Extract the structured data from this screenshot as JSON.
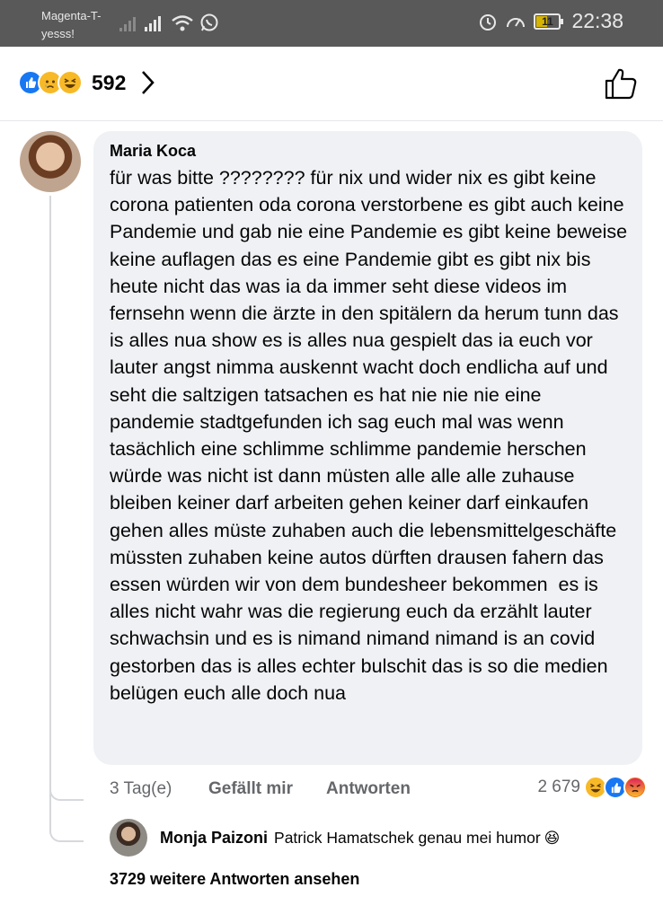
{
  "status_bar": {
    "carrier": "Magenta-T-yesss!",
    "battery": "11",
    "time": "22:38"
  },
  "header": {
    "reaction_count": "592",
    "reactions": [
      "like-icon",
      "sad-icon",
      "haha-icon"
    ]
  },
  "comment": {
    "author": "Maria Koca",
    "text": "für was bitte ???????? für nix und wider nix es gibt keine corona patienten oda corona verstorbene es gibt auch keine Pandemie und gab nie eine Pandemie es gibt keine beweise keine auflagen das es eine Pandemie gibt es gibt nix bis heute nicht das was ia da immer seht diese videos im fernsehn wenn die ärzte in den spitälern da herum tunn das is alles nua show es is alles nua gespielt das ia euch vor lauter angst nimma auskennt wacht doch endlicha auf und seht die saltzigen tatsachen es hat nie nie nie eine pandemie stadtgefunden ich sag euch mal was wenn tasächlich eine schlimme schlimme pandemie herschen würde was nicht ist dann müsten alle alle alle zuhause bleiben keiner darf arbeiten gehen keiner darf einkaufen gehen alles müste zuhaben auch die lebensmittelgeschäfte müssten zuhaben keine autos dürften drausen fahern das essen würden wir von dem bundesheer bekommen  es is alles nicht wahr was die regierung euch da erzählt lauter schwachsin und es is nimand nimand nimand is an covid gestorben das is alles echter bulschit das is so die medien belügen euch alle doch nua",
    "time": "3 Tag(e)",
    "like_label": "Gefällt mir",
    "reply_label": "Antworten",
    "reaction_count": "2 679",
    "reactions": [
      "haha-icon",
      "like-icon",
      "angry-icon"
    ]
  },
  "reply": {
    "author": "Monja Paizoni",
    "text": "Patrick Hamatschek genau mei humor",
    "emoji": "😆"
  },
  "more_replies": "3729 weitere Antworten ansehen",
  "colors": {
    "accent": "#1877f2",
    "bubble": "#eff1f4",
    "secondary_text": "#65676b"
  }
}
